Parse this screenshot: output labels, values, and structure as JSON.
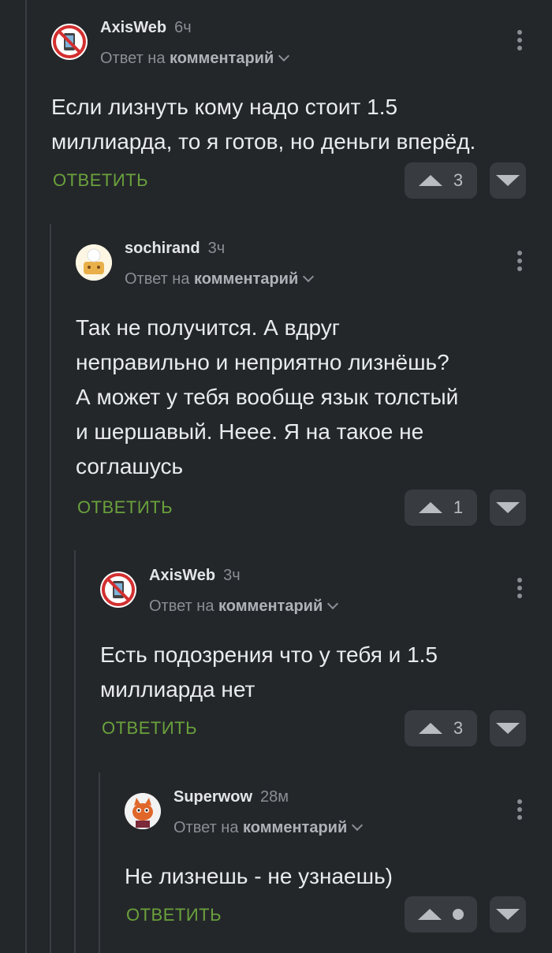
{
  "colors": {
    "background": "#24272a",
    "reply_green": "#6aa13c",
    "vote_bg": "#383c41",
    "muted": "#8a8f95"
  },
  "comments": [
    {
      "user": "AxisWeb",
      "time": "6ч",
      "reply_prefix": "Ответ на",
      "reply_target": "комментарий",
      "text": "Если лизнуть кому надо стоит 1.5\nмиллиарда, то я готов, но деньги вперёд.",
      "reply_label": "ОТВЕТИТЬ",
      "score": "3",
      "avatar_icon": "no-phone-avatar-icon"
    },
    {
      "user": "sochirand",
      "time": "3ч",
      "reply_prefix": "Ответ на",
      "reply_target": "комментарий",
      "text": "Так не получится. А вдруг\nнеправильно и неприятно лизнёшь?\nА может у тебя вообще язык толстый\nи шершавый. Нееe. Я на такое не\nсоглашусь",
      "reply_label": "ОТВЕТИТЬ",
      "score": "1",
      "avatar_icon": "chef-cookie-avatar-icon"
    },
    {
      "user": "AxisWeb",
      "time": "3ч",
      "reply_prefix": "Ответ на",
      "reply_target": "комментарий",
      "text": "Есть подозрения что у тебя и 1.5\nмиллиарда нет",
      "reply_label": "ОТВЕТИТЬ",
      "score": "3",
      "avatar_icon": "no-phone-avatar-icon"
    },
    {
      "user": "Superwow",
      "time": "28м",
      "reply_prefix": "Ответ на",
      "reply_target": "комментарий",
      "text": "Не лизнешь - не узнаешь)",
      "reply_label": "ОТВЕТИТЬ",
      "score": "",
      "avatar_icon": "fox-avatar-icon"
    }
  ]
}
